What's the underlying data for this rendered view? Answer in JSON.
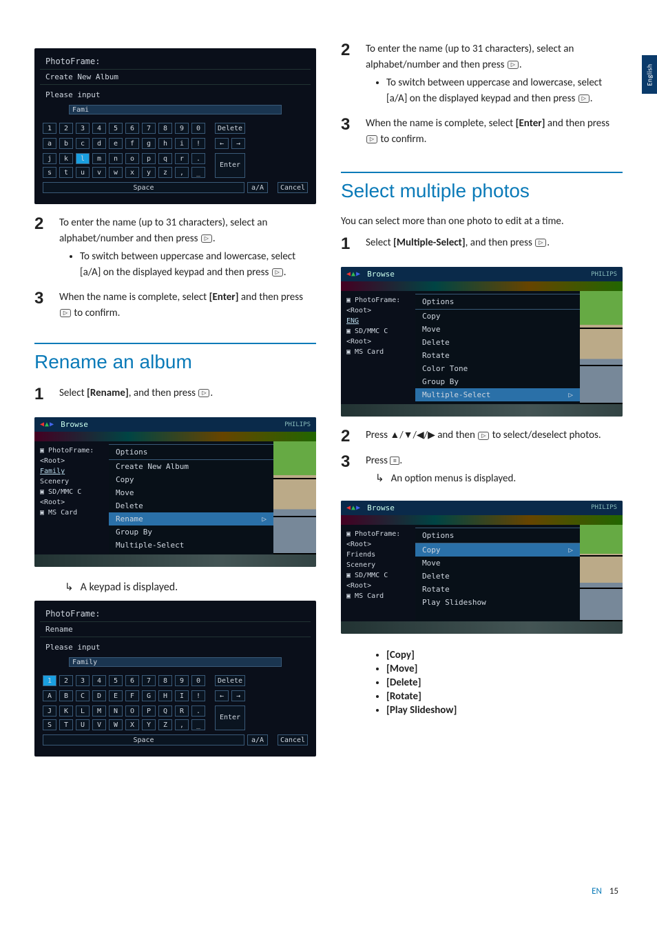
{
  "lang_tab": "English",
  "footer": {
    "lang": "EN",
    "page": "15"
  },
  "left": {
    "device1": {
      "title": "PhotoFrame:",
      "subtitle": "Create New Album",
      "prompt": "Please input",
      "input": "Fami",
      "rows": {
        "r1": [
          "1",
          "2",
          "3",
          "4",
          "5",
          "6",
          "7",
          "8",
          "9",
          "0"
        ],
        "r2": [
          "a",
          "b",
          "c",
          "d",
          "e",
          "f",
          "g",
          "h",
          "i",
          "!"
        ],
        "r3": [
          "j",
          "k",
          "l",
          "m",
          "n",
          "o",
          "p",
          "q",
          "r",
          "."
        ],
        "r4": [
          "s",
          "t",
          "u",
          "v",
          "w",
          "x",
          "y",
          "z",
          ",",
          "_"
        ]
      },
      "delete": "Delete",
      "enter": "Enter",
      "space": "Space",
      "aA": "a/A",
      "cancel": "Cancel",
      "arrows": [
        "←",
        "→"
      ]
    },
    "step2": "To enter the name (up to 31 characters), select an alphabet/number and then press ",
    "step2b": "To switch between uppercase and lowercase, select [a/A] on the displayed keypad and then press ",
    "step3a": "When the name is complete, select ",
    "step3b": "[Enter]",
    "step3c": " and then press ",
    "step3d": " to confirm.",
    "h_rename": "Rename an album",
    "r_step1a": "Select ",
    "r_step1b": "[Rename]",
    "r_step1c": ", and then press ",
    "browse1": {
      "title": "Browse",
      "brand": "PHILIPS",
      "side": [
        "PhotoFrame:",
        "<Root>",
        "Family",
        "Scenery",
        "SD/MMC  C",
        "<Root>",
        "MS  Card"
      ],
      "icon_rows": [
        0,
        4,
        6
      ],
      "menu_head": "Options",
      "menu": [
        "Create New Album",
        "Copy",
        "Move",
        "Delete",
        "Rename",
        "Group By",
        "Multiple-Select"
      ],
      "selected": "Rename"
    },
    "r_result": "A keypad is displayed.",
    "device2": {
      "title": "PhotoFrame:",
      "subtitle": "Rename",
      "prompt": "Please input",
      "input": "Family",
      "rows": {
        "r1": [
          "1",
          "2",
          "3",
          "4",
          "5",
          "6",
          "7",
          "8",
          "9",
          "0"
        ],
        "r2": [
          "A",
          "B",
          "C",
          "D",
          "E",
          "F",
          "G",
          "H",
          "I",
          "!"
        ],
        "r3": [
          "J",
          "K",
          "L",
          "M",
          "N",
          "O",
          "P",
          "Q",
          "R",
          "."
        ],
        "r4": [
          "S",
          "T",
          "U",
          "V",
          "W",
          "X",
          "Y",
          "Z",
          ",",
          "_"
        ]
      },
      "delete": "Delete",
      "enter": "Enter",
      "space": "Space",
      "aA": "a/A",
      "cancel": "Cancel",
      "arrows": [
        "←",
        "→"
      ]
    }
  },
  "right": {
    "step2": "To enter the name (up to 31 characters), select an alphabet/number and then press ",
    "step2b": "To switch between uppercase and lowercase, select [a/A] on the displayed keypad and then press ",
    "step3a": "When the name is complete, select ",
    "step3b": "[Enter]",
    "step3c": " and then press ",
    "step3d": " to confirm.",
    "h_multi": "Select multiple photos",
    "intro": "You can select more than one photo to edit at a time.",
    "m_step1a": "Select ",
    "m_step1b": "[Multiple-Select]",
    "m_step1c": ", and then press ",
    "browse2": {
      "title": "Browse",
      "brand": "PHILIPS",
      "side": [
        "PhotoFrame:",
        "<Root>",
        "ENG",
        "SD/MMC  C",
        "<Root>",
        "MS  Card"
      ],
      "icon_rows": [
        0,
        3,
        5
      ],
      "menu_head": "Options",
      "menu": [
        "Copy",
        "Move",
        "Delete",
        "Rotate",
        "Color Tone",
        "Group By",
        "Multiple-Select"
      ],
      "selected": "Multiple-Select"
    },
    "m_step2a": "Press ",
    "m_step2b": " and then ",
    "m_step2c": " to select/deselect photos.",
    "m_step3a": "Press ",
    "m_result": "An option menus is displayed.",
    "browse3": {
      "title": "Browse",
      "brand": "PHILIPS",
      "side": [
        "PhotoFrame:",
        "<Root>",
        "Friends",
        "Scenery",
        "SD/MMC  C",
        "<Root>",
        "MS  Card"
      ],
      "icon_rows": [
        0,
        4,
        6
      ],
      "menu_head": "Options",
      "menu": [
        "Copy",
        "Move",
        "Delete",
        "Rotate",
        "Play Slideshow"
      ],
      "selected": "Copy"
    },
    "final_bullets": [
      "[Copy]",
      "[Move]",
      "[Delete]",
      "[Rotate]",
      "[Play Slideshow]"
    ]
  }
}
